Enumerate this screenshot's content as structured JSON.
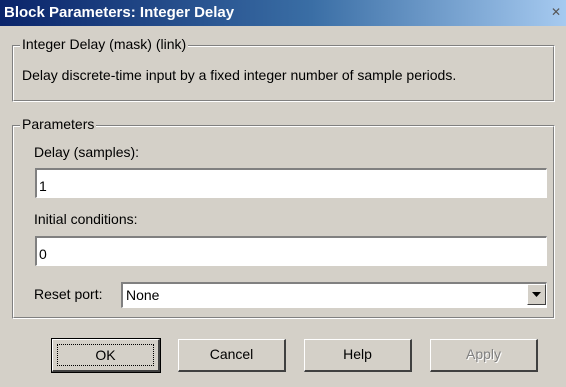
{
  "window": {
    "title": "Block Parameters: Integer Delay",
    "close_glyph": "✕"
  },
  "description_group": {
    "legend": "Integer Delay (mask) (link)",
    "text": "Delay discrete-time input by a fixed integer number of sample periods."
  },
  "parameters_group": {
    "legend": "Parameters",
    "delay_label": "Delay (samples):",
    "delay_value": "1",
    "initial_label": "Initial conditions:",
    "initial_value": "0",
    "reset_label": "Reset port:",
    "reset_value": "None"
  },
  "buttons": {
    "ok": "OK",
    "cancel": "Cancel",
    "help": "Help",
    "apply": "Apply"
  },
  "icons": {
    "close": "close-icon",
    "dropdown": "chevron-down-icon"
  },
  "colors": {
    "titlebar_start": "#0a246a",
    "titlebar_end": "#a6caf0",
    "dialog_bg": "#d4d0c8"
  }
}
